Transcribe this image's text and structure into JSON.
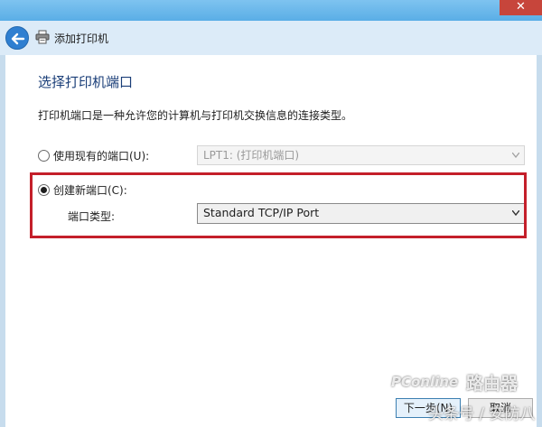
{
  "window": {
    "close_glyph": "✕",
    "accent_color": "#2f7fd1"
  },
  "header": {
    "title": "添加打印机"
  },
  "page": {
    "title": "选择打印机端口",
    "description": "打印机端口是一种允许您的计算机与打印机交换信息的连接类型。"
  },
  "options": {
    "existing": {
      "label": "使用现有的端口(U):",
      "selected": false,
      "dropdown_value": "LPT1: (打印机端口)"
    },
    "create_new": {
      "label": "创建新端口(C):",
      "selected": true,
      "type_label": "端口类型:",
      "dropdown_value": "Standard TCP/IP Port"
    }
  },
  "footer": {
    "next_label": "下一步(N)",
    "cancel_label": "取消"
  },
  "watermark": {
    "logo_text": "PConline",
    "site_text": "路由器",
    "author_text": "头条号 / 安防八"
  },
  "highlight_color": "#c41f2a"
}
